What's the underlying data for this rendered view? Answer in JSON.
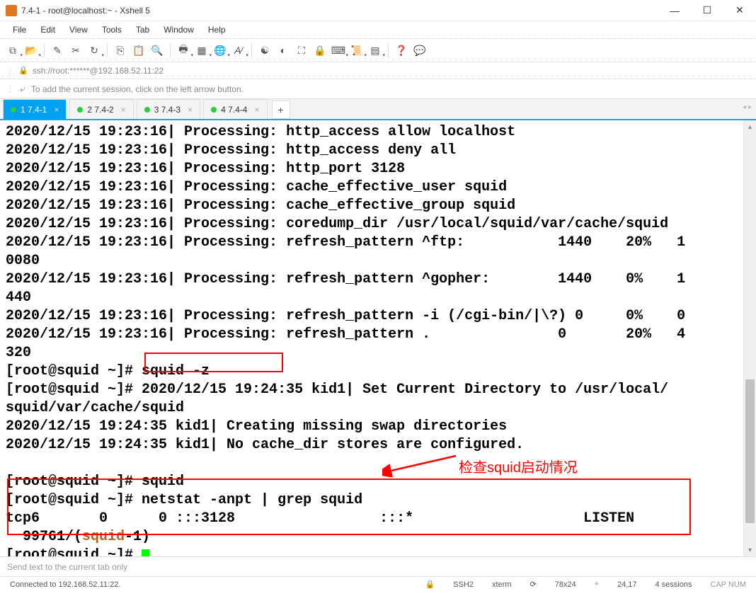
{
  "title": "7.4-1 - root@localhost:~ - Xshell 5",
  "menus": [
    "File",
    "Edit",
    "View",
    "Tools",
    "Tab",
    "Window",
    "Help"
  ],
  "address": "ssh://root:******@192.168.52.11:22",
  "hint": "To add the current session, click on the left arrow button.",
  "tabs": [
    {
      "label": "1 7.4-1",
      "active": true
    },
    {
      "label": "2 7.4-2",
      "active": false
    },
    {
      "label": "3 7.4-3",
      "active": false
    },
    {
      "label": "4 7.4-4",
      "active": false
    }
  ],
  "terminal_lines": [
    "2020/12/15 19:23:16| Processing: http_access allow localhost",
    "2020/12/15 19:23:16| Processing: http_access deny all",
    "2020/12/15 19:23:16| Processing: http_port 3128",
    "2020/12/15 19:23:16| Processing: cache_effective_user squid",
    "2020/12/15 19:23:16| Processing: cache_effective_group squid",
    "2020/12/15 19:23:16| Processing: coredump_dir /usr/local/squid/var/cache/squid",
    "2020/12/15 19:23:16| Processing: refresh_pattern ^ftp:           1440    20%   1",
    "0080",
    "2020/12/15 19:23:16| Processing: refresh_pattern ^gopher:        1440    0%    1",
    "440",
    "2020/12/15 19:23:16| Processing: refresh_pattern -i (/cgi-bin/|\\?) 0     0%    0",
    "2020/12/15 19:23:16| Processing: refresh_pattern .               0       20%   4",
    "320",
    "[root@squid ~]# squid -z",
    "[root@squid ~]# 2020/12/15 19:24:35 kid1| Set Current Directory to /usr/local/",
    "squid/var/cache/squid",
    "2020/12/15 19:24:35 kid1| Creating missing swap directories",
    "2020/12/15 19:24:35 kid1| No cache_dir stores are configured.",
    "",
    "[root@squid ~]# squid",
    "[root@squid ~]# netstat -anpt | grep squid",
    "tcp6       0      0 :::3128                 :::*                    LISTEN    ",
    "  99761/(squid-1)",
    "[root@squid ~]# "
  ],
  "squid_highlight": "squid",
  "annotation": "检查squid启动情况",
  "input_placeholder": "Send text to the current tab only",
  "status": {
    "conn": "Connected to 192.168.52.11:22.",
    "proto": "SSH2",
    "term": "xterm",
    "size": "78x24",
    "cursor": "24,17",
    "sessions": "4 sessions",
    "caps": "CAP  NUM"
  }
}
